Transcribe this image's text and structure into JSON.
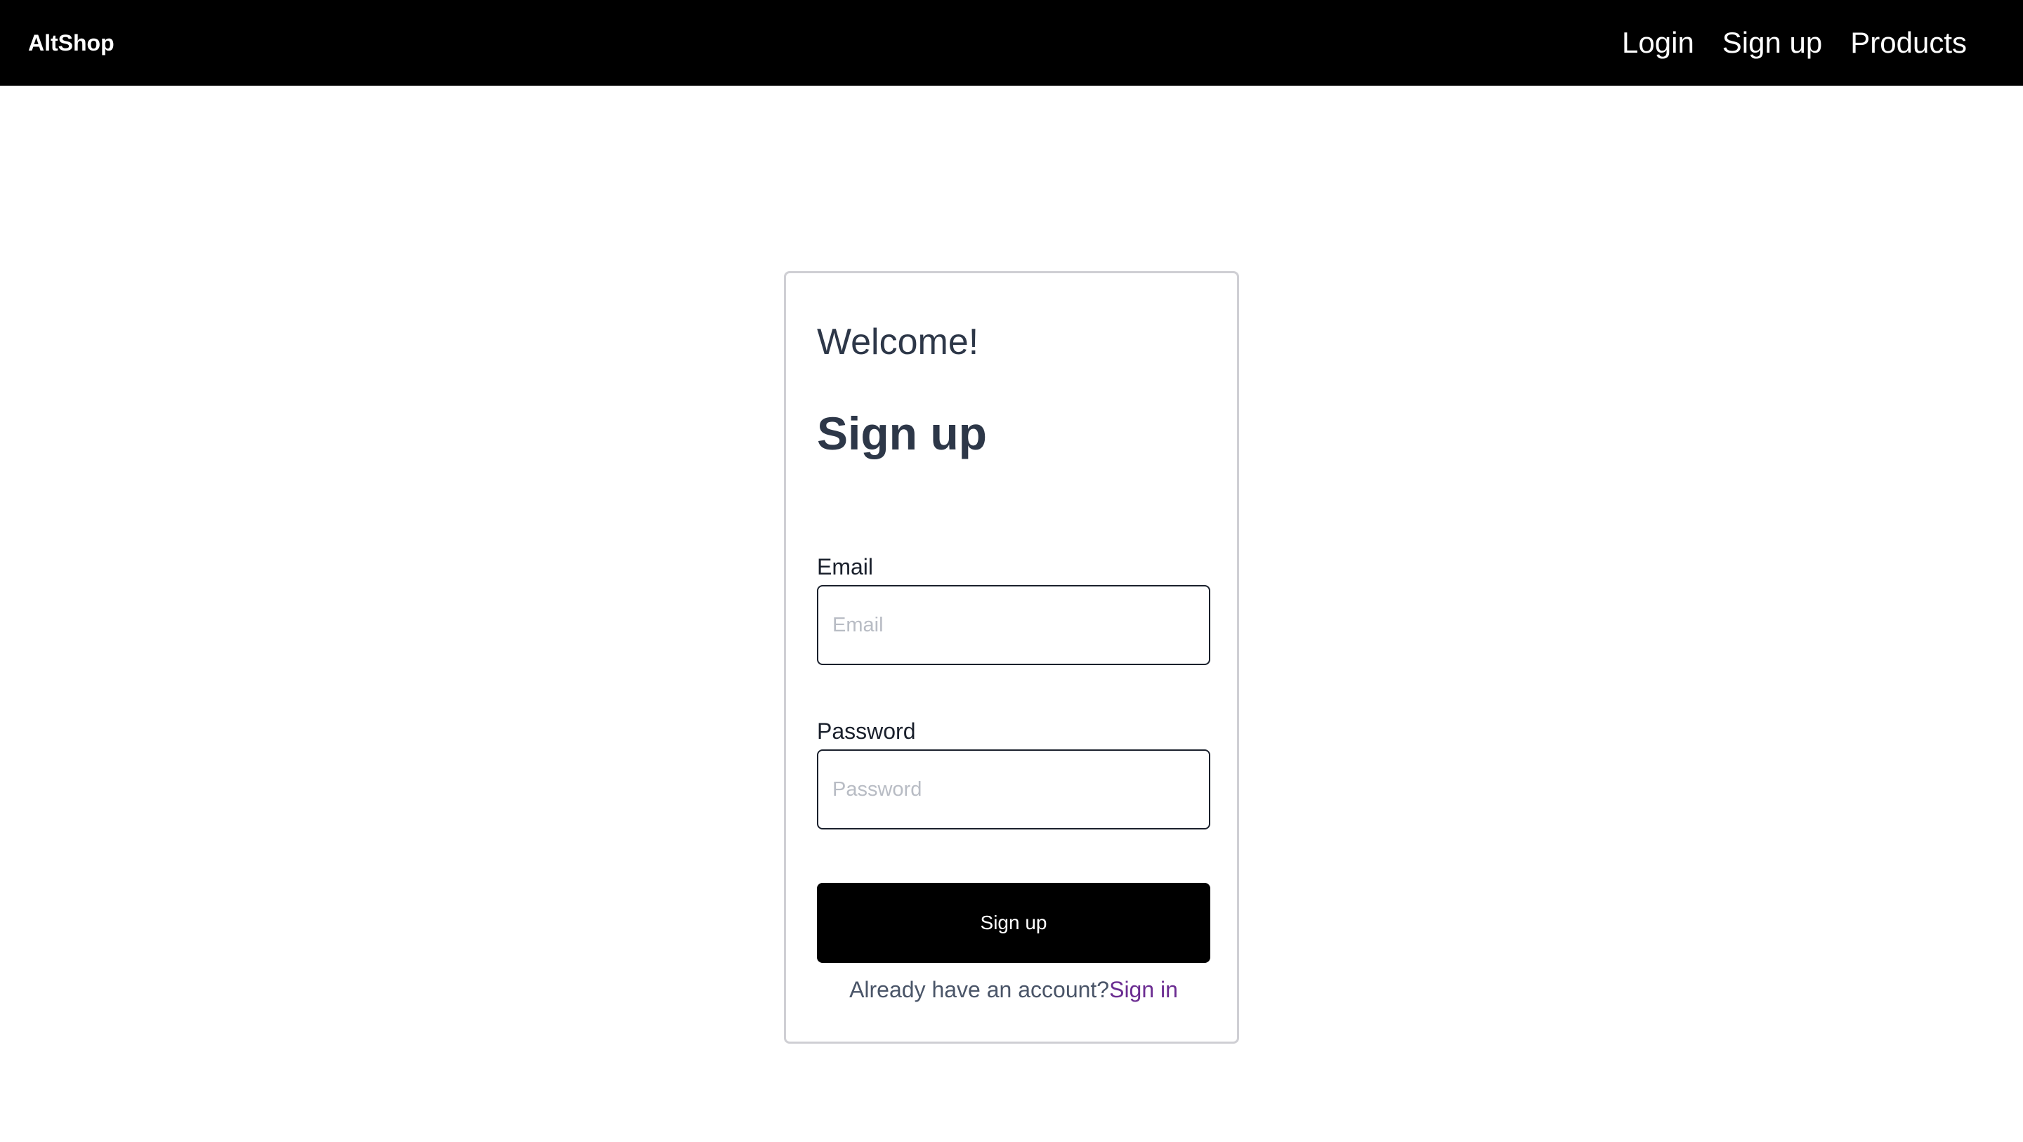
{
  "navbar": {
    "brand": "AltShop",
    "links": [
      {
        "label": "Login"
      },
      {
        "label": "Sign up"
      },
      {
        "label": "Products"
      }
    ]
  },
  "form": {
    "welcome": "Welcome!",
    "title": "Sign up",
    "email": {
      "label": "Email",
      "placeholder": "Email",
      "value": ""
    },
    "password": {
      "label": "Password",
      "placeholder": "Password",
      "value": ""
    },
    "submit_label": "Sign up",
    "footer_text": "Already have an account?",
    "footer_link": "Sign in"
  },
  "colors": {
    "navbar_bg": "#000000",
    "text_dark": "#2d3748",
    "link_purple": "#6b2c91",
    "button_bg": "#000000",
    "card_border": "#cfcfd4"
  }
}
